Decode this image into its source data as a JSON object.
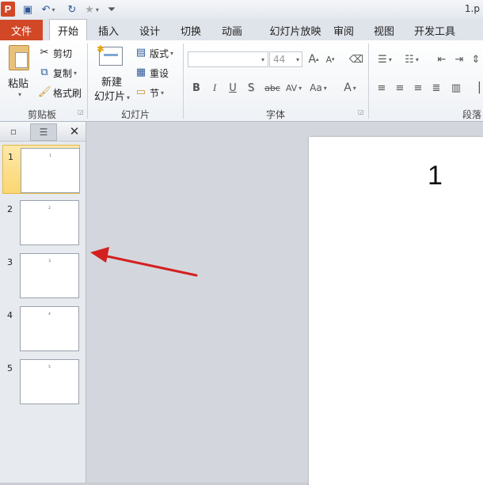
{
  "title_bar": {
    "app_logo": "P",
    "filename": "1.p",
    "qat_icons": [
      "save-icon",
      "undo-icon",
      "redo-icon",
      "star-icon",
      "customize-icon"
    ]
  },
  "tabs": [
    "文件",
    "开始",
    "插入",
    "设计",
    "切换",
    "动画",
    "幻灯片放映",
    "审阅",
    "视图",
    "开发工具"
  ],
  "ribbon": {
    "clipboard": {
      "label": "剪贴板",
      "paste": "粘贴",
      "cut": "剪切",
      "copy": "复制",
      "format_painter": "格式刷"
    },
    "slides": {
      "label": "幻灯片",
      "new_slide_line1": "新建",
      "new_slide_line2": "幻灯片",
      "layout": "版式",
      "reset": "重设",
      "section": "节"
    },
    "font": {
      "label": "字体",
      "font_name": "",
      "font_size": "44",
      "buttons": [
        "B",
        "I",
        "U",
        "S",
        "abc",
        "AV",
        "Aa",
        "A"
      ]
    },
    "paragraph": {
      "label": "段落"
    }
  },
  "panel": {
    "slide_numbers": [
      "1",
      "2",
      "3",
      "4",
      "5"
    ],
    "thumb_texts": [
      "1",
      "2",
      "3",
      "4",
      "5"
    ]
  },
  "slide": {
    "title": "1"
  },
  "colors": {
    "file_tab": "#d24726",
    "selected_thumb": "#fbd672",
    "arrow": "#d42020"
  }
}
